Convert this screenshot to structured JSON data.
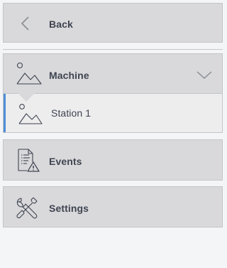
{
  "nav": {
    "back": {
      "label": "Back",
      "icon": "chevron-left-icon"
    },
    "machine": {
      "label": "Machine",
      "icon": "image-icon",
      "expanded": true,
      "toggle_icon": "chevron-down-icon"
    },
    "station": {
      "label": "Station 1",
      "icon": "image-icon",
      "selected": true
    },
    "events": {
      "label": "Events",
      "icon": "document-warning-icon"
    },
    "settings": {
      "label": "Settings",
      "icon": "tools-icon"
    }
  },
  "colors": {
    "accent": "#4c8fd6",
    "button_bg": "#d9d9db",
    "text": "#3f4451"
  }
}
